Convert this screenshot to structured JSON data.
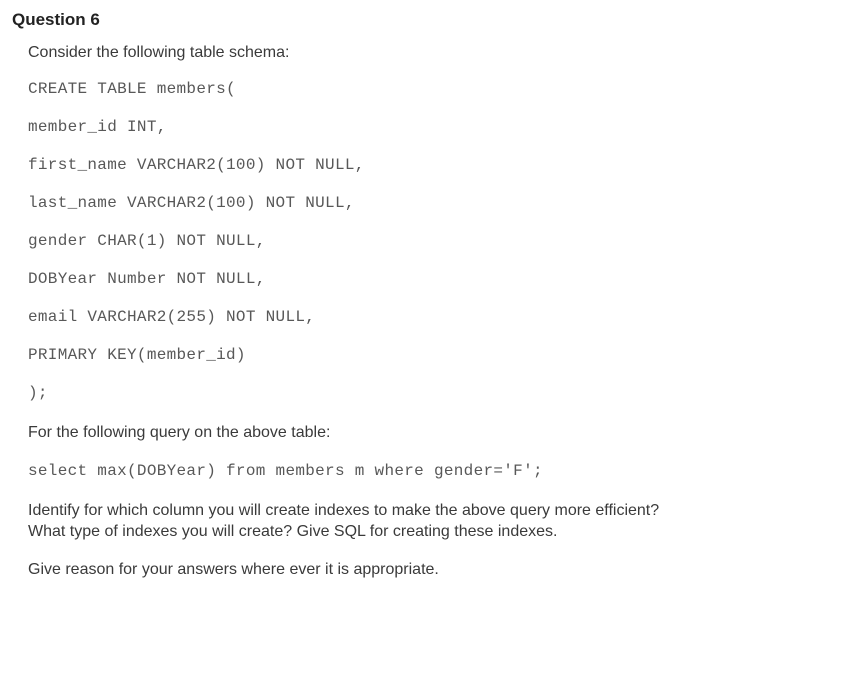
{
  "title": "Question 6",
  "intro": "Consider the following table schema:",
  "code": {
    "l1": "CREATE TABLE members(",
    "l2": "member_id INT,",
    "l3": "first_name VARCHAR2(100) NOT NULL,",
    "l4": "last_name VARCHAR2(100) NOT NULL,",
    "l5": "gender CHAR(1) NOT NULL,",
    "l6": "DOBYear Number NOT NULL,",
    "l7": "email VARCHAR2(255) NOT NULL,",
    "l8": "PRIMARY KEY(member_id)",
    "l9": ");"
  },
  "query_intro": "For the following query on the above table:",
  "query": "select max(DOBYear) from members m where gender='F';",
  "task": "Identify for which column you will create indexes to make the above query more efficient? What type of indexes you will create? Give SQL for creating these indexes.",
  "reason": "Give reason for your answers where ever it is appropriate."
}
